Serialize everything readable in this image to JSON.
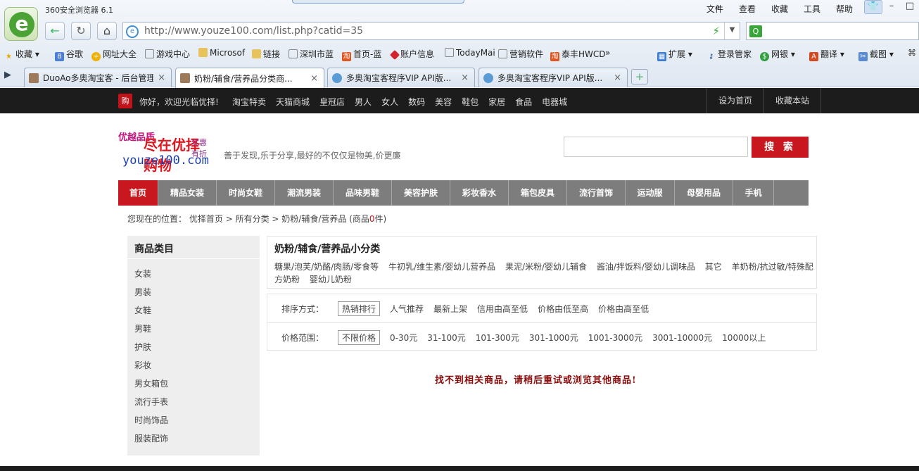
{
  "browser": {
    "app_title": "360安全浏览器 6.1",
    "menu": [
      "文件",
      "查看",
      "收藏",
      "工具",
      "帮助"
    ],
    "address_url": "http://www.youze100.com/list.php?catid=35",
    "favorites": [
      "收藏",
      "谷歌",
      "网址大全",
      "游戏中心",
      "Microsof",
      "链接",
      "深圳市蓝",
      "首页-蓝",
      "账户信息",
      "TodayMai",
      "营销软件",
      "泰丰HWCD"
    ],
    "toolbar_right": [
      "扩展",
      "登录管家",
      "网银",
      "翻译",
      "截图"
    ],
    "tabs": [
      {
        "label": "DuoAo多奥淘宝客 - 后台管理",
        "active": false
      },
      {
        "label": "奶粉/辅食/营养品分类商...",
        "active": true
      },
      {
        "label": "多奥淘宝客程序VIP API版...",
        "active": false
      },
      {
        "label": "多奥淘宝客程序VIP API版...",
        "active": false
      }
    ]
  },
  "site": {
    "topbar": {
      "welcome": "你好，欢迎光临优择!",
      "links": [
        "淘宝特卖",
        "天猫商城",
        "皇冠店",
        "男人",
        "女人",
        "数码",
        "美容",
        "鞋包",
        "家居",
        "食品",
        "电器城"
      ],
      "right_links": [
        "设为首页",
        "收藏本站"
      ]
    },
    "logo": {
      "line1": "优越品质",
      "line2": "尽在优择购物",
      "line3": "优惠有折",
      "domain": "youze100.com"
    },
    "slogan": "善于发现,乐于分享,最好的不仅仅是物美,价更廉",
    "search_button": "搜 索",
    "category_nav": [
      "首页",
      "精品女装",
      "时尚女鞋",
      "潮流男装",
      "品味男鞋",
      "美容护肤",
      "彩妆香水",
      "箱包皮具",
      "流行首饰",
      "运动服",
      "母婴用品",
      "手机"
    ],
    "breadcrumb": {
      "prefix": "您现在的位置：",
      "home": "优择首页",
      "sep": " > ",
      "all": "所有分类",
      "current": "奶粉/辅食/营养品",
      "count_pre": " (商品",
      "count": "0",
      "count_post": "件)"
    },
    "sidebar": {
      "title": "商品类目",
      "items": [
        "女装",
        "男装",
        "女鞋",
        "男鞋",
        "护肤",
        "彩妆",
        "男女箱包",
        "流行手表",
        "时尚饰品",
        "服装配饰"
      ]
    },
    "subcategory": {
      "title": "奶粉/辅食/营养品小分类",
      "links": [
        "糖果/泡芙/奶酪/肉肠/零食等",
        "牛初乳/维生素/婴幼儿营养品",
        "果泥/米粉/婴幼儿辅食",
        "酱油/拌饭料/婴幼儿调味品",
        "其它",
        "羊奶粉/抗过敏/特殊配方奶粉",
        "婴幼儿奶粉"
      ]
    },
    "sort": {
      "label": "排序方式：",
      "selected": "热销排行",
      "options": [
        "人气推荐",
        "最新上架",
        "信用由高至低",
        "价格由低至高",
        "价格由高至低"
      ]
    },
    "price": {
      "label": "价格范围：",
      "selected": "不限价格",
      "options": [
        "0-30元",
        "31-100元",
        "101-300元",
        "301-1000元",
        "1001-3000元",
        "3001-10000元",
        "10000以上"
      ]
    },
    "empty_message": "找不到相关商品，请稍后重试或浏览其他商品!"
  }
}
